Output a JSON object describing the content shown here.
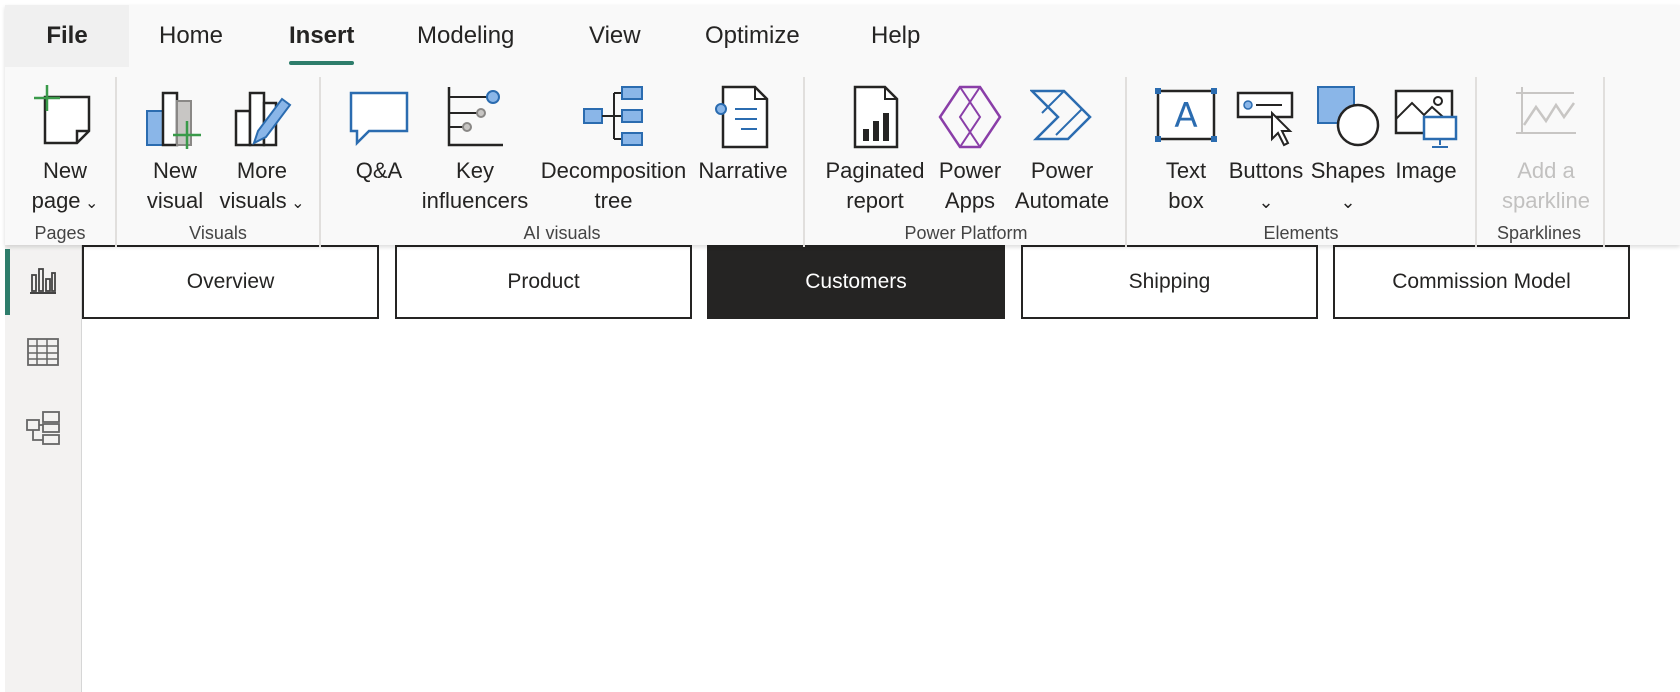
{
  "ribbon": {
    "tabs": [
      "File",
      "Home",
      "Insert",
      "Modeling",
      "View",
      "Optimize",
      "Help"
    ],
    "active_tab": "Insert",
    "groups": {
      "pages": {
        "label": "Pages",
        "new_page": [
          "New",
          "page"
        ]
      },
      "visuals": {
        "label": "Visuals",
        "new_visual": [
          "New",
          "visual"
        ],
        "more_visuals": [
          "More",
          "visuals"
        ]
      },
      "ai_visuals": {
        "label": "AI visuals",
        "qa": "Q&A",
        "key_influencers": [
          "Key",
          "influencers"
        ],
        "decomposition_tree": [
          "Decomposition",
          "tree"
        ],
        "narrative": "Narrative"
      },
      "power_platform": {
        "label": "Power Platform",
        "paginated_report": [
          "Paginated",
          "report"
        ],
        "power_apps": [
          "Power",
          "Apps"
        ],
        "power_automate": [
          "Power",
          "Automate"
        ]
      },
      "elements": {
        "label": "Elements",
        "text_box": [
          "Text",
          "box"
        ],
        "buttons": "Buttons",
        "shapes": "Shapes",
        "image": "Image"
      },
      "sparklines": {
        "label": "Sparklines",
        "add_sparkline": [
          "Add a",
          "sparkline"
        ]
      }
    }
  },
  "page_tabs": [
    "Overview",
    "Product",
    "Customers",
    "Shipping",
    "Commission Model"
  ],
  "selected_page": "Customers",
  "colors": {
    "accent": "#2e7d6b",
    "icon_blue": "#2b6cb0",
    "icon_blue_fill": "#8ab6e8",
    "power_apps_purple": "#8a3ea8",
    "selected_tab_bg": "#252423"
  }
}
